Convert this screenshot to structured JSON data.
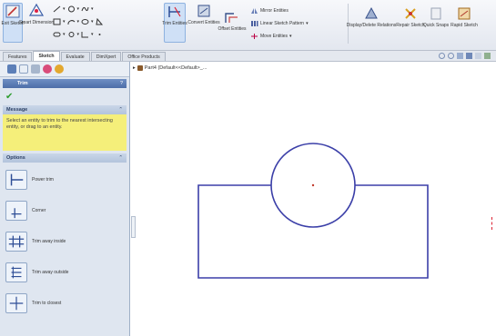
{
  "ribbon": {
    "buttons": [
      {
        "label": "Exit Sketch",
        "icon": "exit-sketch-icon"
      },
      {
        "label": "Smart Dimension",
        "icon": "smart-dimension-icon"
      },
      {
        "label": "Trim Entities",
        "icon": "trim-entities-icon"
      },
      {
        "label": "Convert Entities",
        "icon": "convert-entities-icon"
      },
      {
        "label": "Offset Entities",
        "icon": "offset-entities-icon"
      },
      {
        "label": "Display/Delete Relations",
        "icon": "relations-icon"
      },
      {
        "label": "Repair Sketch",
        "icon": "repair-sketch-icon"
      },
      {
        "label": "Quick Snaps",
        "icon": "quick-snaps-icon"
      },
      {
        "label": "Rapid Sketch",
        "icon": "rapid-sketch-icon"
      }
    ],
    "small_tools": [
      {
        "label": "Mirror Entities",
        "icon": "mirror-icon"
      },
      {
        "label": "Linear Sketch Pattern",
        "icon": "linear-pattern-icon"
      },
      {
        "label": "Move Entities",
        "icon": "move-icon"
      }
    ]
  },
  "tabs": [
    {
      "label": "Features",
      "active": false
    },
    {
      "label": "Sketch",
      "active": true
    },
    {
      "label": "Evaluate",
      "active": false
    },
    {
      "label": "DimXpert",
      "active": false
    },
    {
      "label": "Office Products",
      "active": false
    }
  ],
  "panel": {
    "title": "Trim",
    "message_header": "Message",
    "message_text": "Select an entity to trim to the nearest intersecting entity, or drag to an entity.",
    "options_header": "Options",
    "options": [
      {
        "label": "Power trim",
        "icon": "power-trim-icon"
      },
      {
        "label": "Corner",
        "icon": "corner-trim-icon"
      },
      {
        "label": "Trim away inside",
        "icon": "trim-inside-icon"
      },
      {
        "label": "Trim away outside",
        "icon": "trim-outside-icon"
      },
      {
        "label": "Trim to closest",
        "icon": "trim-closest-icon"
      }
    ]
  },
  "canvas": {
    "tree_item": "Part4 (Default<<Default>_..."
  },
  "colors": {
    "sketch_line": "#3b3fa8",
    "message_bg": "#f5ef7a",
    "title_bar": "#4d6ea8"
  }
}
